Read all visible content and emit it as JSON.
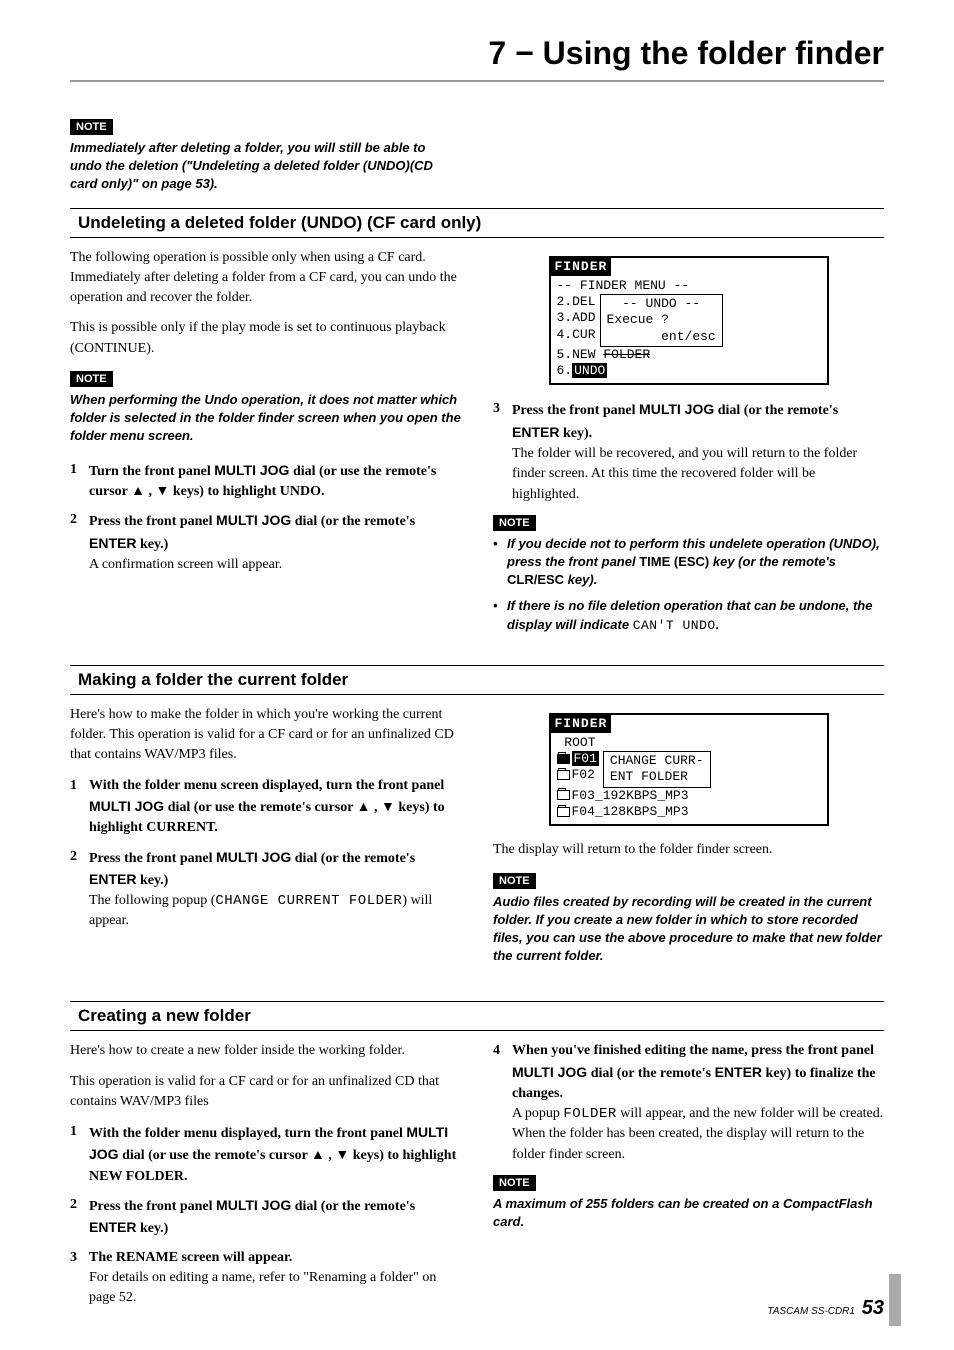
{
  "chapter_title": "7 − Using the folder finder",
  "labels": {
    "note": "NOTE"
  },
  "intro_note": "Immediately after deleting a folder, you will still be able to undo the deletion (\"Undeleting a deleted folder (UNDO)(CD card only)\" on page 53).",
  "undo": {
    "title": "Undeleting a deleted folder (UNDO) (CF card only)",
    "para1": "The following operation is possible only when using a CF card. Immediately after deleting a folder from a CF card, you can undo the operation and recover the folder.",
    "para2": "This is possible only if the play mode is set to continuous playback (CONTINUE).",
    "note1": "When performing the Undo operation, it does not matter which folder is selected in the folder finder screen when you open the folder menu screen.",
    "step1": {
      "pre": "Turn the front panel ",
      "mj": "MULTI JOG",
      "post": " dial (or use the remote's cursor ▲ , ▼ keys) to highlight UNDO."
    },
    "step2": {
      "pre": "Press the front panel ",
      "mj": "MULTI JOG",
      "mid": " dial (or the remote's ",
      "enter": "ENTER",
      "post": " key.)",
      "desc": "A confirmation screen will appear."
    },
    "lcd1": {
      "header": "FINDER",
      "menu_title": "-- FINDER MENU --",
      "r1": "2.DEL",
      "r2": "3.ADD",
      "r3": "4.CUR",
      "r4_pre": "5.NEW ",
      "r4_strike": "FOLDER",
      "r5_pre": "6.",
      "r5_hl": "UNDO",
      "popup_l1": "  -- UNDO --",
      "popup_l2": "Execue ?",
      "popup_l3": "       ent/esc"
    },
    "step3": {
      "pre": "Press the front panel ",
      "mj": "MULTI JOG",
      "mid": " dial (or the remote's ",
      "enter": "ENTER",
      "post": " key).",
      "desc": "The folder will be recovered, and you will return to the folder finder screen. At this time the recovered folder will be highlighted."
    },
    "bnote1": {
      "pre": "If you decide not to perform this undelete operation (UNDO), press the front panel ",
      "t1": "TIME (ESC)",
      "mid": " key (or the remote's ",
      "t2": "CLR/ESC",
      "post": " key)."
    },
    "bnote2": {
      "pre": "If there is no file deletion operation that can be undone, the display will indicate ",
      "mono": "CAN'T UNDO",
      "post": "."
    }
  },
  "current": {
    "title": "Making a folder the current folder",
    "para1": "Here's how to make the folder in which you're working the current folder. This operation is valid for a CF card or for an unfinalized CD that contains WAV/MP3 files.",
    "step1": {
      "pre": "With the folder menu screen displayed, turn the front panel ",
      "mj": "MULTI JOG",
      "post": " dial (or use the remote's cursor ▲ , ▼ keys) to highlight CURRENT."
    },
    "step2": {
      "pre": "Press the front panel ",
      "mj": "MULTI JOG",
      "mid": " dial (or the remote's ",
      "enter": "ENTER",
      "post": " key.)",
      "desc_pre": "The following popup (",
      "desc_mono": "CHANGE CURRENT FOLDER",
      "desc_post": ") will appear."
    },
    "lcd2": {
      "header": "FINDER",
      "root": " ROOT",
      "r1_hl": "F01",
      "r2": "F02",
      "r3": "F03_192KBPS_MP3",
      "r4": "F04_128KBPS_MP3",
      "popup_l1": "CHANGE CURR-",
      "popup_l2": "ENT FOLDER"
    },
    "after": "The display will return to the folder finder screen.",
    "note1": "Audio files created by recording will be created in the current folder. If you create a new folder in which to store recorded files, you can use the above procedure to make that new folder the current folder."
  },
  "create": {
    "title": "Creating a new folder",
    "para1": "Here's how to create a new folder inside the working folder.",
    "para2": "This operation is valid for a CF card or for an unfinalized CD that contains WAV/MP3 files",
    "step1": {
      "pre": "With the folder menu displayed, turn the front panel ",
      "mj": "MULTI JOG",
      "post": " dial (or use the remote's cursor ▲ , ▼ keys) to highlight NEW FOLDER."
    },
    "step2": {
      "pre": "Press the front panel ",
      "mj": "MULTI JOG",
      "mid": " dial (or the remote's ",
      "enter": "ENTER",
      "post": " key.)"
    },
    "step3": {
      "title": "The RENAME screen will appear.",
      "desc": "For details on editing a name, refer to \"Renaming a folder\" on page 52."
    },
    "step4": {
      "pre": "When you've finished editing the name, press the front panel ",
      "mj": "MULTI JOG",
      "mid": " dial (or the remote's ",
      "enter": "ENTER",
      "post": " key) to finalize the changes.",
      "desc1_pre": "A popup ",
      "desc1_mono": "FOLDER",
      "desc1_post": " will appear, and the new folder will be created.",
      "desc2": "When the folder has been created, the display will return to the folder finder screen."
    },
    "note1": "A maximum of 255 folders can be created on a CompactFlash card."
  },
  "footer": {
    "product": "TASCAM  SS-CDR1",
    "page": "53"
  }
}
